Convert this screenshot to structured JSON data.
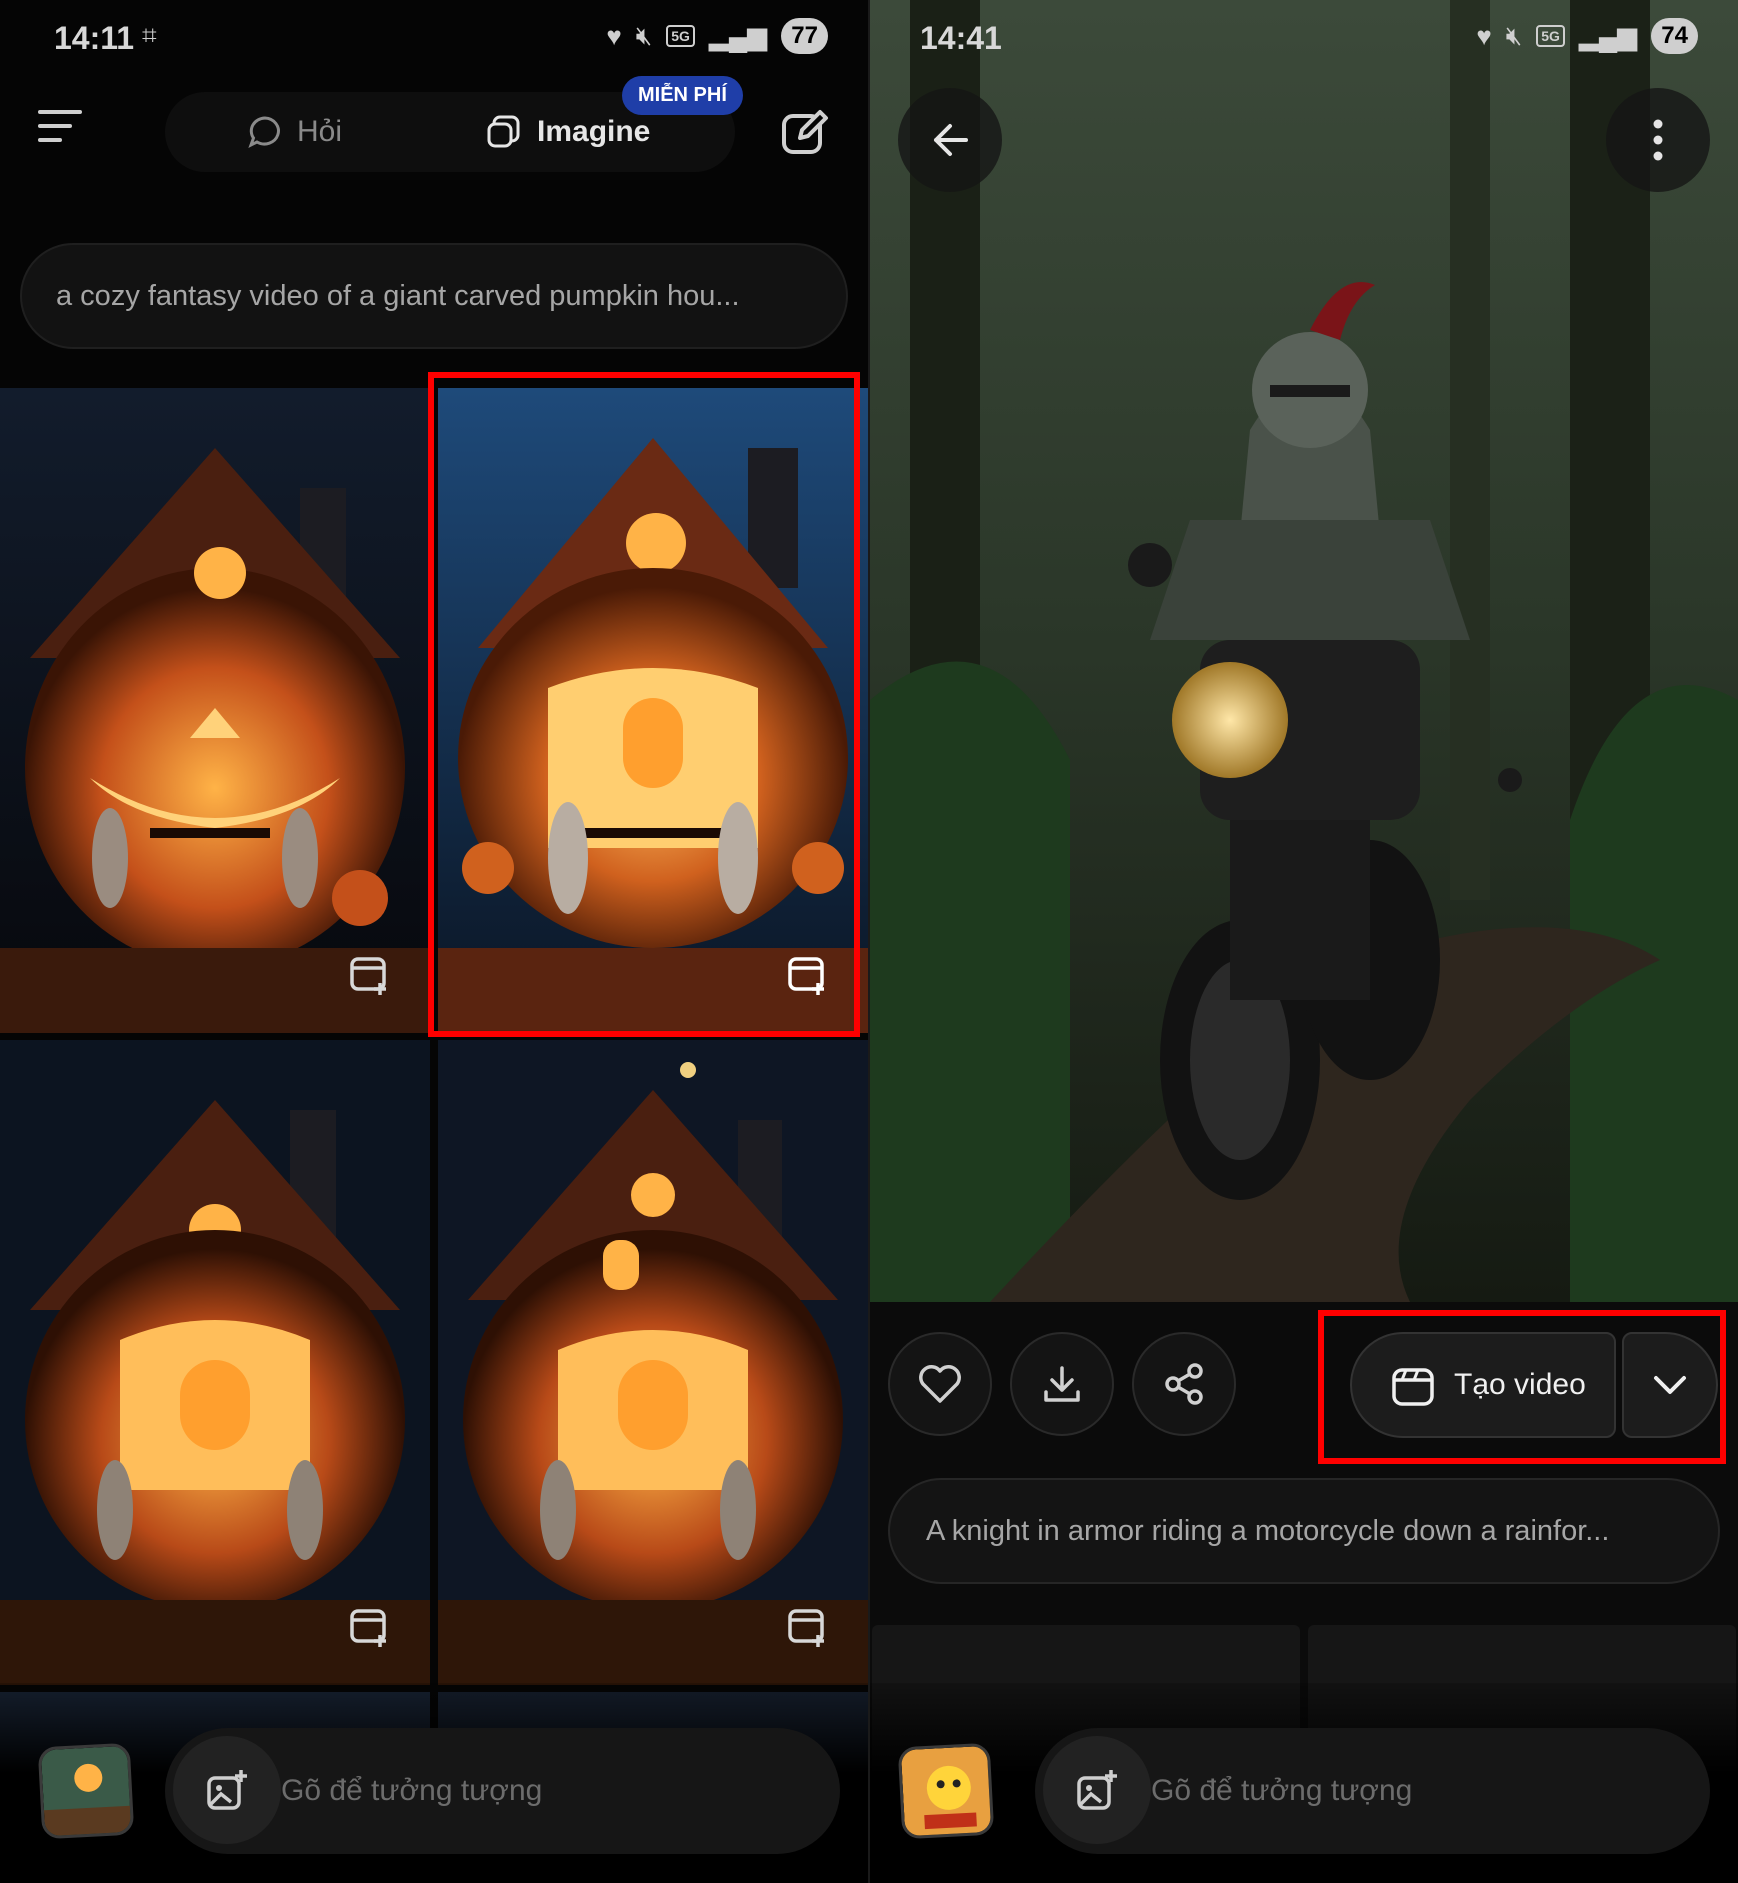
{
  "left": {
    "status": {
      "time": "14:11",
      "battery": "77",
      "network": "5G"
    },
    "nav": {
      "ask_label": "Hỏi",
      "imagine_label": "Imagine",
      "free_badge": "MIỄN PHÍ"
    },
    "prompt": "a cozy fantasy video of a giant carved pumpkin hou...",
    "grid": {
      "tiles": [
        {
          "variant": "jack-o-lantern face house",
          "selected": false
        },
        {
          "variant": "pumpkin house, round window",
          "selected": true
        },
        {
          "variant": "pumpkin house, arched window",
          "selected": false
        },
        {
          "variant": "pumpkin house, multi-window",
          "selected": false
        }
      ]
    },
    "input": {
      "placeholder": "Gõ để tưởng tượng"
    }
  },
  "right": {
    "status": {
      "time": "14:41",
      "battery": "74",
      "network": "5G"
    },
    "actions": {
      "create_video_label": "Tạo video"
    },
    "prompt": "A knight in armor riding a motorcycle down a rainfor...",
    "input": {
      "placeholder": "Gõ để tưởng tượng"
    }
  },
  "colors": {
    "highlight": "#ff0000",
    "free_badge": "#1f3ea8",
    "pumpkin": "#e0671e",
    "glow": "#ffb347",
    "forest": "#2f3d2c"
  },
  "icons": [
    "menu-icon",
    "chat-bubble-icon",
    "imagine-icon",
    "edit-icon",
    "video-add-icon",
    "image-add-icon",
    "back-arrow-icon",
    "more-vertical-icon",
    "heart-icon",
    "download-icon",
    "share-icon",
    "clapperboard-icon",
    "chevron-down-icon"
  ]
}
